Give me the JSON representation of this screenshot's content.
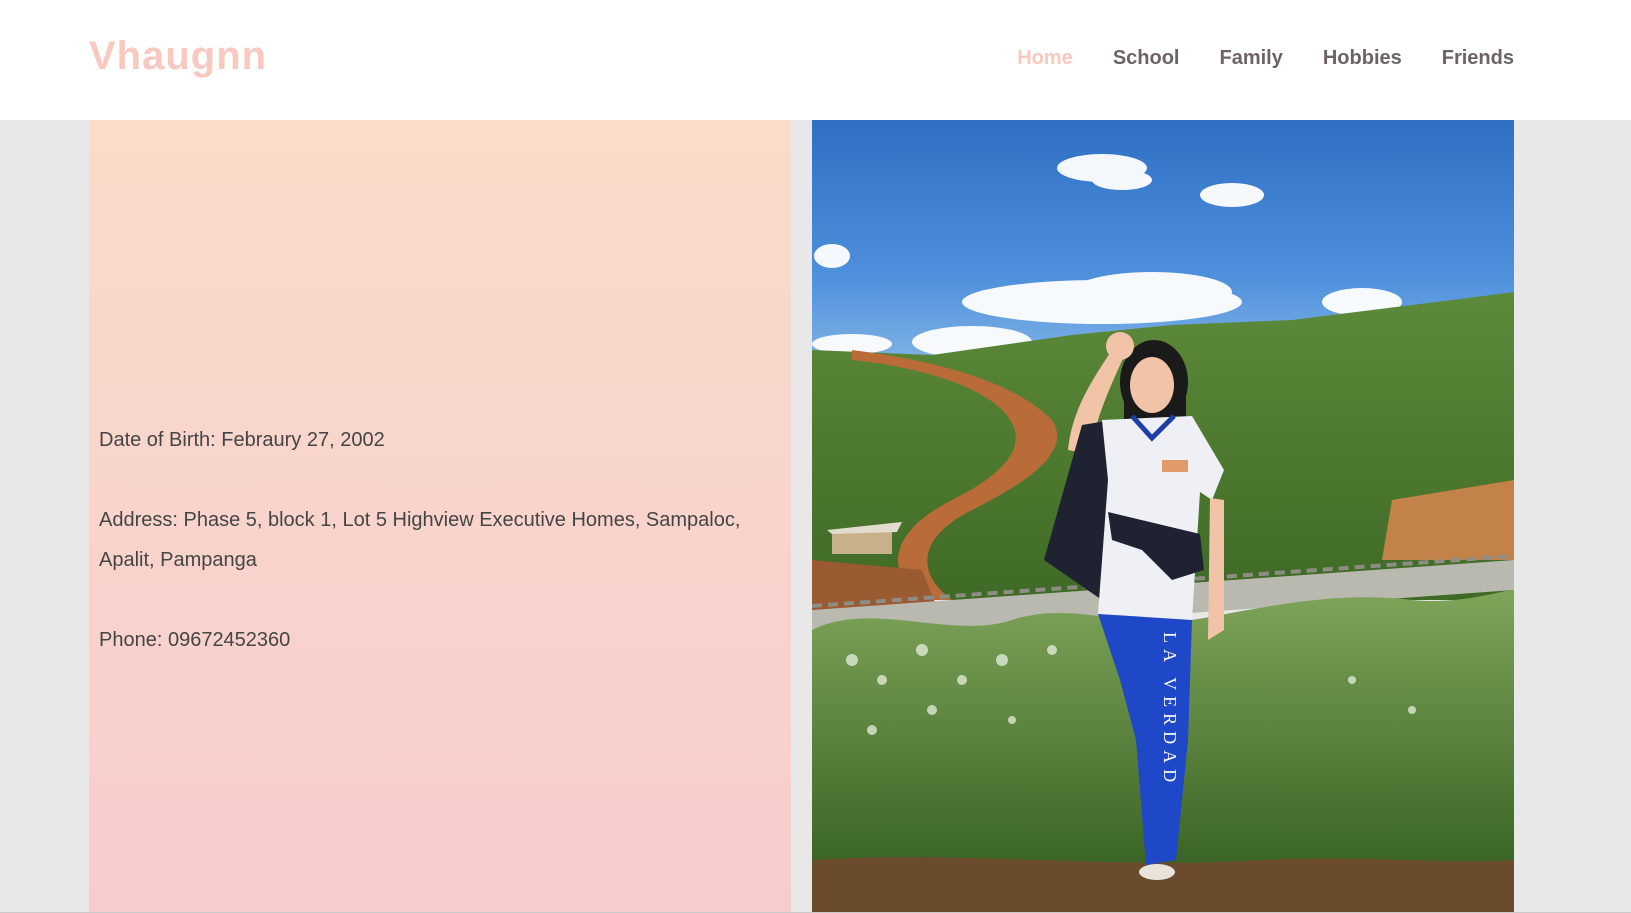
{
  "brand": "Vhaugnn",
  "nav": {
    "home": "Home",
    "school": "School",
    "family": "Family",
    "hobbies": "Hobbies",
    "friends": "Friends"
  },
  "profile": {
    "dob": "Date of Birth: Febraury 27, 2002",
    "address": "Address: Phase 5, block 1, Lot 5 Highview Executive Homes, Sampaloc, Apalit, Pampanga",
    "phone": "Phone: 09672452360"
  },
  "photo": {
    "pants_text": "LA VERDAD"
  },
  "colors": {
    "accent": "#f9c9c0",
    "nav_text": "#6d6363",
    "panel_top": "#f9dcca",
    "panel_bottom": "#f7cccd",
    "page_bg": "#e8e8e8"
  }
}
